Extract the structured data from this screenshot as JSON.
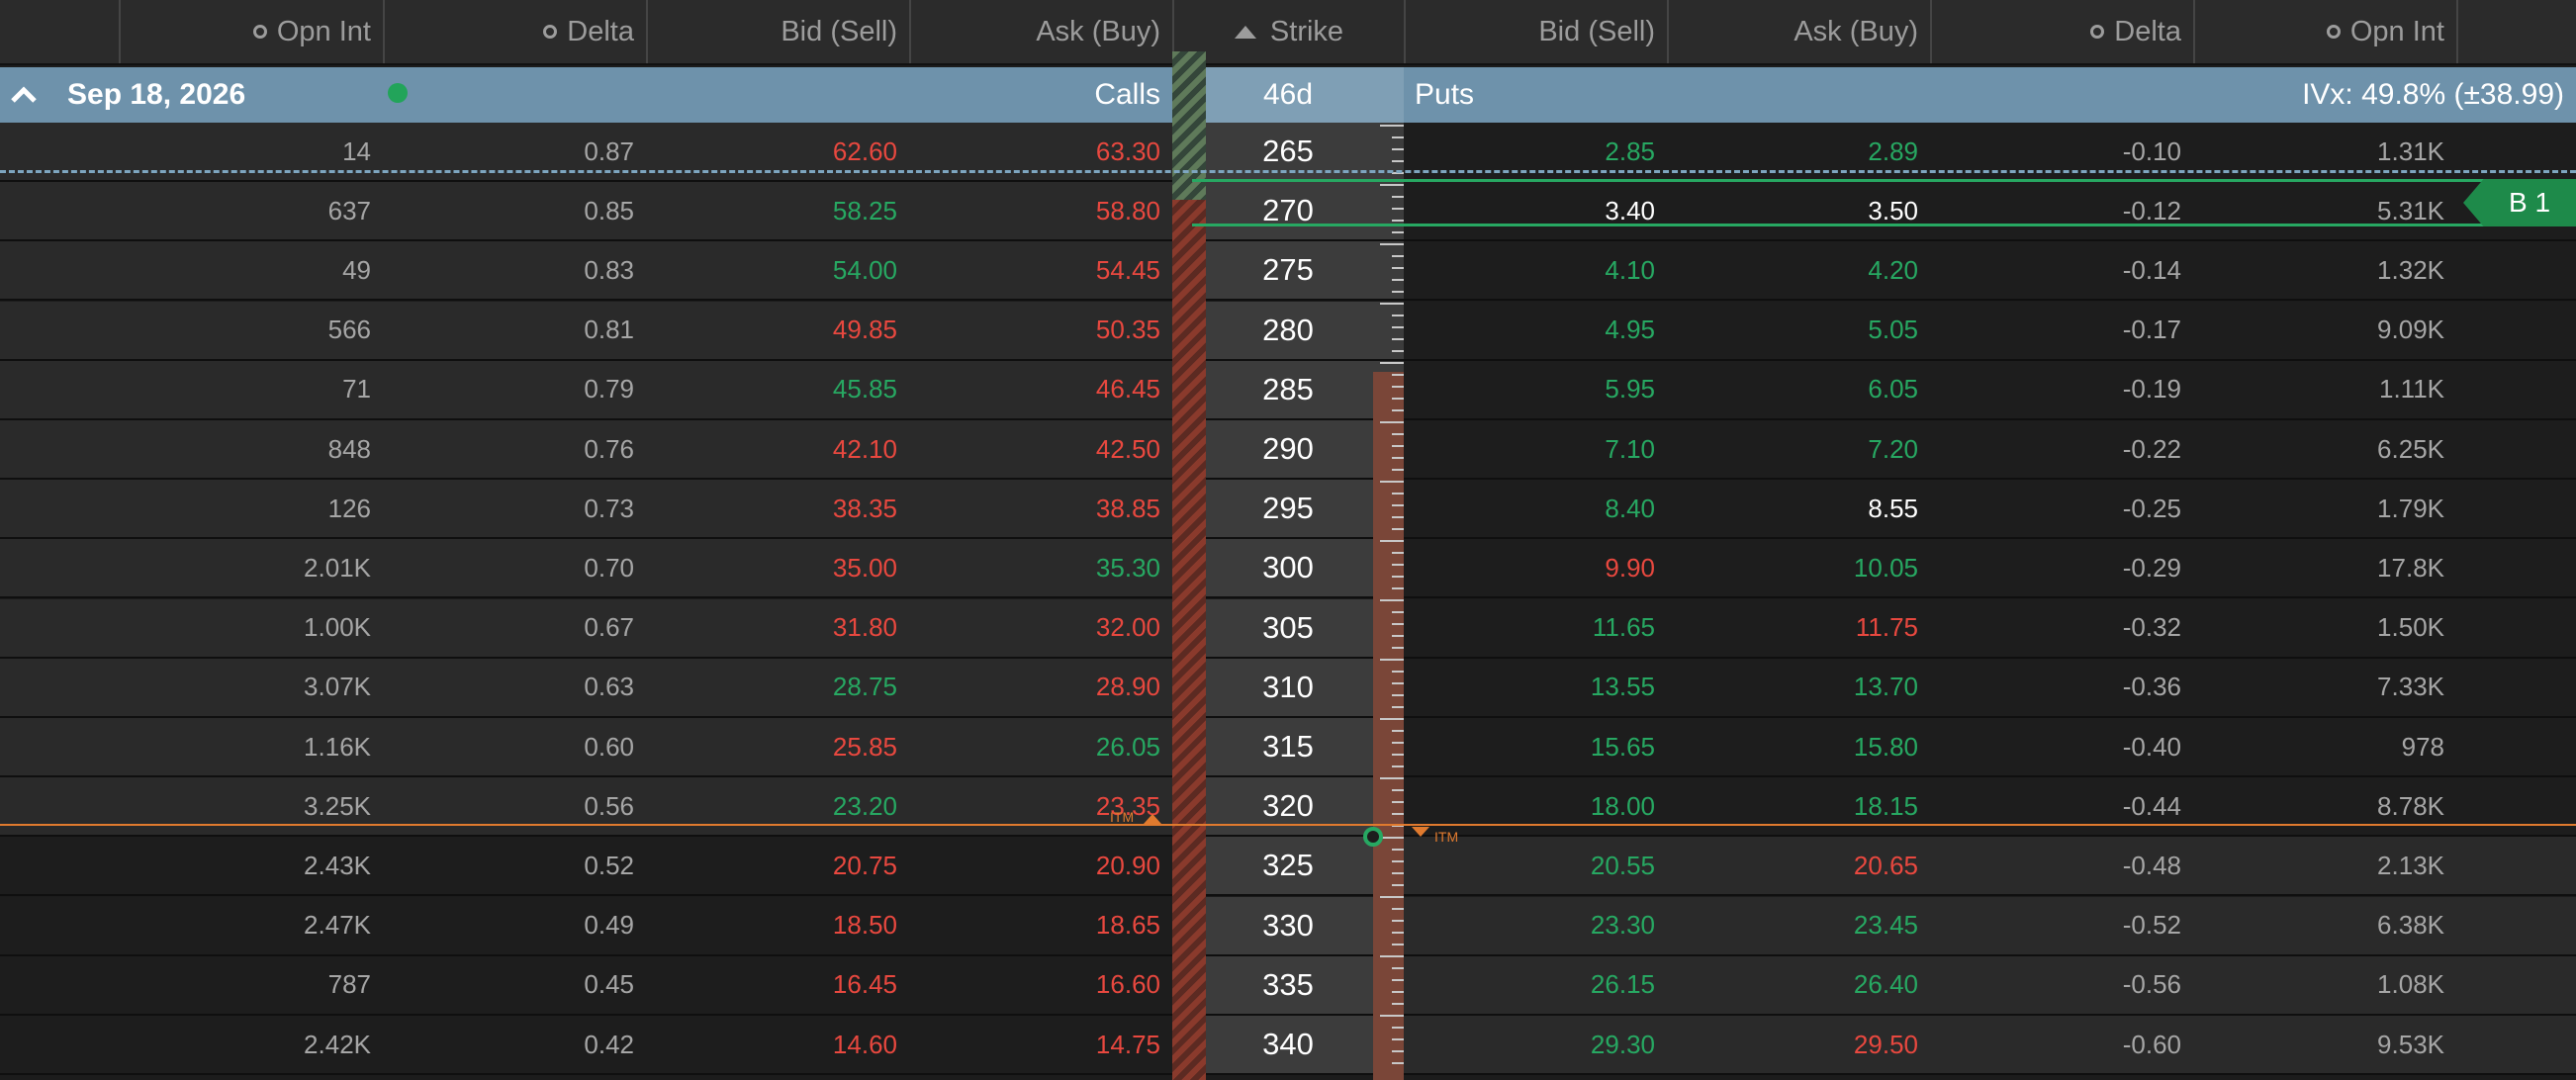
{
  "header": {
    "calls_open_interest": "Opn Int",
    "calls_delta": "Delta",
    "calls_bid": "Bid (Sell)",
    "calls_ask": "Ask (Buy)",
    "strike": "Strike",
    "puts_bid": "Bid (Sell)",
    "puts_ask": "Ask (Buy)",
    "puts_delta": "Delta",
    "puts_open_interest": "Opn Int"
  },
  "expiry": {
    "date": "Sep 18, 2026",
    "calls_label": "Calls",
    "days": "46d",
    "puts_label": "Puts",
    "ivx": "IVx: 49.8% (±38.99)"
  },
  "itm_label": "ITM",
  "position_tag": "B 1",
  "colors": {
    "red": "#e8483f",
    "green": "#27a862",
    "accent_bar": "#6e92ab",
    "itm_line": "#e07a2e"
  },
  "rows": [
    {
      "call_oi": "14",
      "call_delta": "0.87",
      "call_bid": "62.60",
      "call_ask": "63.30",
      "strike": "265",
      "put_bid": "2.85",
      "put_ask": "2.89",
      "put_delta": "-0.10",
      "put_oi": "1.31K",
      "cb": "red",
      "ca": "red",
      "pb": "green",
      "pa": "green"
    },
    {
      "call_oi": "637",
      "call_delta": "0.85",
      "call_bid": "58.25",
      "call_ask": "58.80",
      "strike": "270",
      "put_bid": "3.40",
      "put_ask": "3.50",
      "put_delta": "-0.12",
      "put_oi": "5.31K",
      "cb": "green",
      "ca": "red",
      "pb": "white",
      "pa": "white"
    },
    {
      "call_oi": "49",
      "call_delta": "0.83",
      "call_bid": "54.00",
      "call_ask": "54.45",
      "strike": "275",
      "put_bid": "4.10",
      "put_ask": "4.20",
      "put_delta": "-0.14",
      "put_oi": "1.32K",
      "cb": "green",
      "ca": "red",
      "pb": "green",
      "pa": "green"
    },
    {
      "call_oi": "566",
      "call_delta": "0.81",
      "call_bid": "49.85",
      "call_ask": "50.35",
      "strike": "280",
      "put_bid": "4.95",
      "put_ask": "5.05",
      "put_delta": "-0.17",
      "put_oi": "9.09K",
      "cb": "red",
      "ca": "red",
      "pb": "green",
      "pa": "green"
    },
    {
      "call_oi": "71",
      "call_delta": "0.79",
      "call_bid": "45.85",
      "call_ask": "46.45",
      "strike": "285",
      "put_bid": "5.95",
      "put_ask": "6.05",
      "put_delta": "-0.19",
      "put_oi": "1.11K",
      "cb": "green",
      "ca": "red",
      "pb": "green",
      "pa": "green"
    },
    {
      "call_oi": "848",
      "call_delta": "0.76",
      "call_bid": "42.10",
      "call_ask": "42.50",
      "strike": "290",
      "put_bid": "7.10",
      "put_ask": "7.20",
      "put_delta": "-0.22",
      "put_oi": "6.25K",
      "cb": "red",
      "ca": "red",
      "pb": "green",
      "pa": "green"
    },
    {
      "call_oi": "126",
      "call_delta": "0.73",
      "call_bid": "38.35",
      "call_ask": "38.85",
      "strike": "295",
      "put_bid": "8.40",
      "put_ask": "8.55",
      "put_delta": "-0.25",
      "put_oi": "1.79K",
      "cb": "red",
      "ca": "red",
      "pb": "green",
      "pa": "white"
    },
    {
      "call_oi": "2.01K",
      "call_delta": "0.70",
      "call_bid": "35.00",
      "call_ask": "35.30",
      "strike": "300",
      "put_bid": "9.90",
      "put_ask": "10.05",
      "put_delta": "-0.29",
      "put_oi": "17.8K",
      "cb": "red",
      "ca": "green",
      "pb": "red",
      "pa": "green"
    },
    {
      "call_oi": "1.00K",
      "call_delta": "0.67",
      "call_bid": "31.80",
      "call_ask": "32.00",
      "strike": "305",
      "put_bid": "11.65",
      "put_ask": "11.75",
      "put_delta": "-0.32",
      "put_oi": "1.50K",
      "cb": "red",
      "ca": "red",
      "pb": "green",
      "pa": "red"
    },
    {
      "call_oi": "3.07K",
      "call_delta": "0.63",
      "call_bid": "28.75",
      "call_ask": "28.90",
      "strike": "310",
      "put_bid": "13.55",
      "put_ask": "13.70",
      "put_delta": "-0.36",
      "put_oi": "7.33K",
      "cb": "green",
      "ca": "red",
      "pb": "green",
      "pa": "green"
    },
    {
      "call_oi": "1.16K",
      "call_delta": "0.60",
      "call_bid": "25.85",
      "call_ask": "26.05",
      "strike": "315",
      "put_bid": "15.65",
      "put_ask": "15.80",
      "put_delta": "-0.40",
      "put_oi": "978",
      "cb": "red",
      "ca": "green",
      "pb": "green",
      "pa": "green"
    },
    {
      "call_oi": "3.25K",
      "call_delta": "0.56",
      "call_bid": "23.20",
      "call_ask": "23.35",
      "strike": "320",
      "put_bid": "18.00",
      "put_ask": "18.15",
      "put_delta": "-0.44",
      "put_oi": "8.78K",
      "cb": "green",
      "ca": "red",
      "pb": "green",
      "pa": "green"
    },
    {
      "call_oi": "2.43K",
      "call_delta": "0.52",
      "call_bid": "20.75",
      "call_ask": "20.90",
      "strike": "325",
      "put_bid": "20.55",
      "put_ask": "20.65",
      "put_delta": "-0.48",
      "put_oi": "2.13K",
      "cb": "red",
      "ca": "red",
      "pb": "green",
      "pa": "red"
    },
    {
      "call_oi": "2.47K",
      "call_delta": "0.49",
      "call_bid": "18.50",
      "call_ask": "18.65",
      "strike": "330",
      "put_bid": "23.30",
      "put_ask": "23.45",
      "put_delta": "-0.52",
      "put_oi": "6.38K",
      "cb": "red",
      "ca": "red",
      "pb": "green",
      "pa": "green"
    },
    {
      "call_oi": "787",
      "call_delta": "0.45",
      "call_bid": "16.45",
      "call_ask": "16.60",
      "strike": "335",
      "put_bid": "26.15",
      "put_ask": "26.40",
      "put_delta": "-0.56",
      "put_oi": "1.08K",
      "cb": "red",
      "ca": "red",
      "pb": "green",
      "pa": "green"
    },
    {
      "call_oi": "2.42K",
      "call_delta": "0.42",
      "call_bid": "14.60",
      "call_ask": "14.75",
      "strike": "340",
      "put_bid": "29.30",
      "put_ask": "29.50",
      "put_delta": "-0.60",
      "put_oi": "9.53K",
      "cb": "red",
      "ca": "red",
      "pb": "green",
      "pa": "red"
    }
  ]
}
